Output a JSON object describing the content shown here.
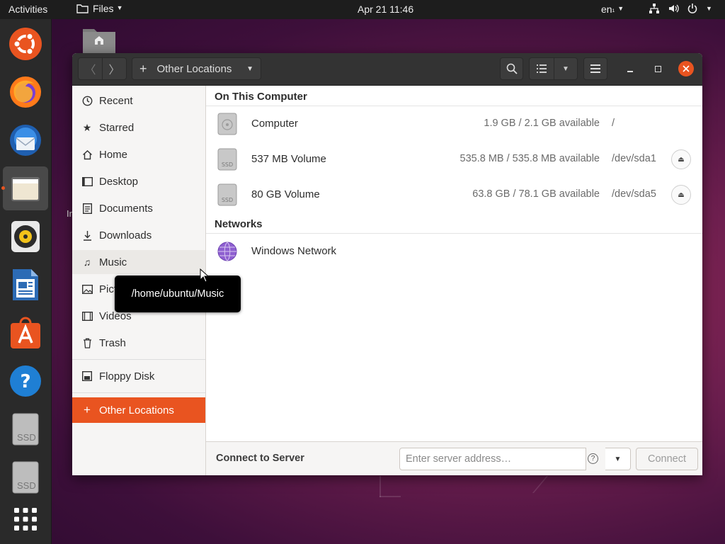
{
  "topbar": {
    "activities": "Activities",
    "app_menu": "Files",
    "clock": "Apr 21  11:46",
    "language": "en",
    "lang_suffix": "₁"
  },
  "dock": {
    "items": [
      "ubuntu-icon",
      "firefox-icon",
      "thunderbird-icon",
      "files-icon",
      "rhythmbox-icon",
      "libreoffice-writer-icon",
      "software-center-icon",
      "help-icon",
      "ssd-drive-icon",
      "ssd-drive-icon",
      "show-apps-icon"
    ],
    "ssd_label": "SSD",
    "accent": "#e95420"
  },
  "window": {
    "location_label": "Other Locations",
    "sidebar": {
      "items": [
        {
          "label": "Recent",
          "icon": "clock-icon"
        },
        {
          "label": "Starred",
          "icon": "star-icon"
        },
        {
          "label": "Home",
          "icon": "home-icon"
        },
        {
          "label": "Desktop",
          "icon": "desktop-icon"
        },
        {
          "label": "Documents",
          "icon": "document-icon"
        },
        {
          "label": "Downloads",
          "icon": "download-icon"
        },
        {
          "label": "Music",
          "icon": "music-icon"
        },
        {
          "label": "Pictures",
          "visible_text": "Pict",
          "icon": "picture-icon"
        },
        {
          "label": "Videos",
          "icon": "video-icon"
        },
        {
          "label": "Trash",
          "icon": "trash-icon"
        },
        {
          "label": "Floppy Disk",
          "icon": "floppy-icon"
        },
        {
          "label": "Other Locations",
          "icon": "plus-icon"
        }
      ]
    },
    "on_this_computer": {
      "title": "On This Computer",
      "rows": [
        {
          "name": "Computer",
          "space": "1.9 GB / 2.1 GB available",
          "path": "/"
        },
        {
          "name": "537 MB Volume",
          "space": "535.8 MB / 535.8 MB available",
          "path": "/dev/sda1"
        },
        {
          "name": "80 GB Volume",
          "space": "63.8 GB / 78.1 GB available",
          "path": "/dev/sda5"
        }
      ]
    },
    "networks": {
      "title": "Networks",
      "rows": [
        {
          "name": "Windows Network"
        }
      ]
    },
    "connect": {
      "label": "Connect to Server",
      "placeholder": "Enter server address…",
      "button": "Connect"
    }
  },
  "tooltip": {
    "text": "/home/ubuntu/Music"
  },
  "desktop_partial_text": "In"
}
